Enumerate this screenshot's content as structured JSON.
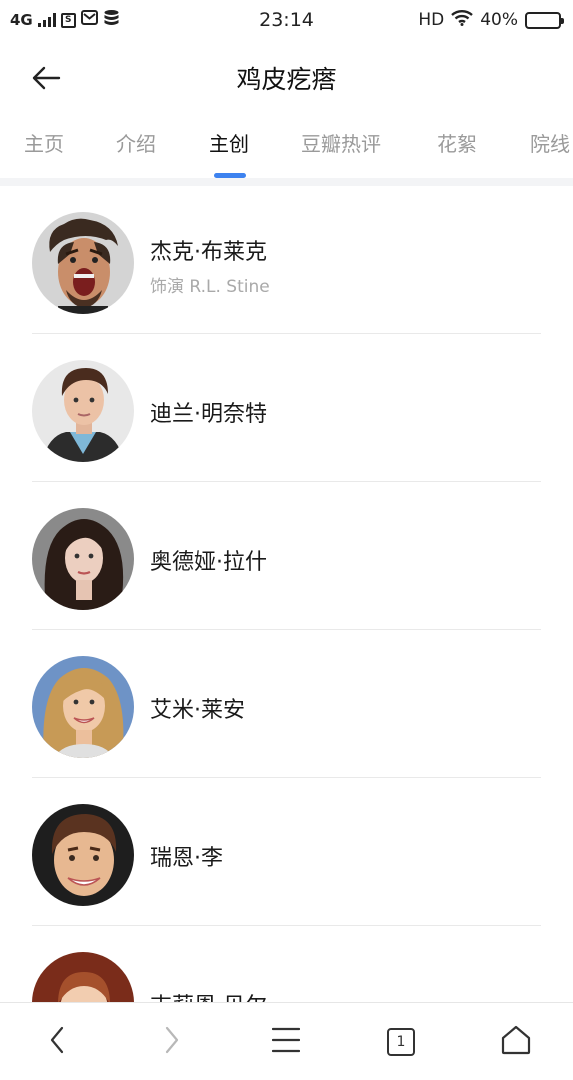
{
  "status_bar": {
    "network": "4G",
    "time": "23:14",
    "hd_label": "HD",
    "battery_percent": "40%",
    "battery_level": 0.4,
    "icons": [
      "signal-icon",
      "sim-s-icon",
      "mail-icon",
      "storage-icon",
      "wifi-icon",
      "battery-icon"
    ]
  },
  "header": {
    "title": "鸡皮疙瘩",
    "back_icon": "back-arrow-icon"
  },
  "tabs": [
    {
      "label": "主页",
      "active": false
    },
    {
      "label": "介绍",
      "active": false
    },
    {
      "label": "主创",
      "active": true
    },
    {
      "label": "豆瓣热评",
      "active": false
    },
    {
      "label": "花絮",
      "active": false
    },
    {
      "label": "院线",
      "active": false
    }
  ],
  "accent_color": "#3d82ef",
  "cast": [
    {
      "name": "杰克·布莱克",
      "role": "饰演 R.L. Stine"
    },
    {
      "name": "迪兰·明奈特",
      "role": ""
    },
    {
      "name": "奥德娅·拉什",
      "role": ""
    },
    {
      "name": "艾米·莱安",
      "role": ""
    },
    {
      "name": "瑞恩·李",
      "role": ""
    },
    {
      "name": "吉莉恩·贝尔",
      "role": ""
    }
  ],
  "bottom_nav": {
    "tab_count": "1",
    "icons": [
      "back-icon",
      "forward-icon",
      "menu-icon",
      "tabs-icon",
      "home-icon"
    ]
  }
}
